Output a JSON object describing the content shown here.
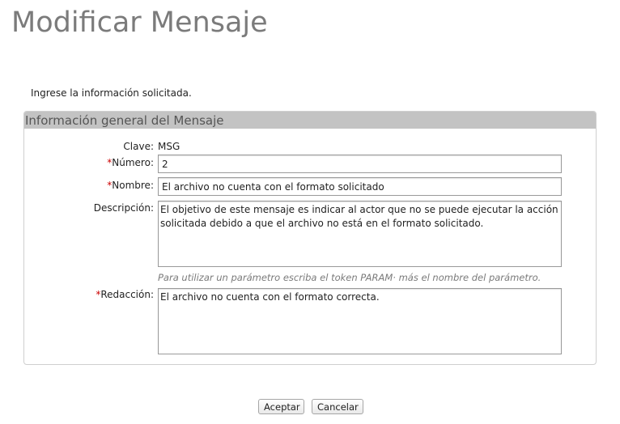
{
  "page": {
    "title": "Modificar Mensaje",
    "instructions": "Ingrese la información solicitada."
  },
  "panel": {
    "title": "Información general del Mensaje"
  },
  "form": {
    "required_mark": "*",
    "clave": {
      "label": "Clave:",
      "value": "MSG"
    },
    "numero": {
      "label": "Número:",
      "value": "2"
    },
    "nombre": {
      "label": "Nombre:",
      "value": "El archivo no cuenta con el formato solicitado"
    },
    "descripcion": {
      "label": "Descripción:",
      "value": "El objetivo de este mensaje es indicar al actor que no se puede ejecutar la acción solicitada debido a que el archivo no está en el formato solicitado."
    },
    "hint": "Para utilizar un parámetro escriba el token PARAM· más el nombre del parámetro.",
    "redaccion": {
      "label": "Redacción:",
      "value": "El archivo no cuenta con el formato correcta."
    }
  },
  "actions": {
    "accept_label": "Aceptar",
    "cancel_label": "Cancelar"
  },
  "colors": {
    "title": "#7b7b7b",
    "panel_header": "#c3c3c3",
    "required": "#cc0000",
    "hint": "#7a7a7a"
  }
}
